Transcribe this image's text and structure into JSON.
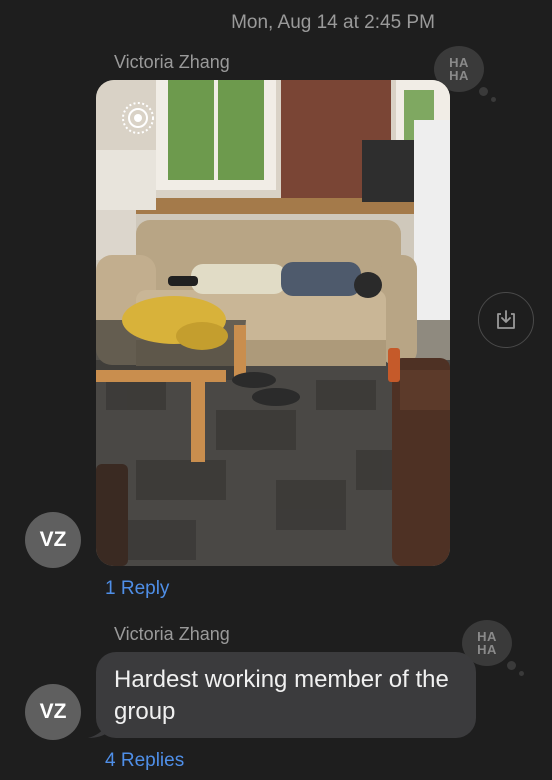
{
  "conversation": {
    "timestamp": "Mon, Aug 14 at 2:45 PM"
  },
  "messages": [
    {
      "sender": "Victoria Zhang",
      "avatar_initials": "VZ",
      "type": "photo",
      "tapback": "HA HA",
      "tapback_line1": "HA",
      "tapback_line2": "HA",
      "live_photo_icon": "live-photo-icon",
      "save_icon": "save-download-icon",
      "reply_count_label": "1 Reply"
    },
    {
      "sender": "Victoria Zhang",
      "avatar_initials": "VZ",
      "type": "text",
      "text": "Hardest working member of the group",
      "tapback": "HA HA",
      "tapback_line1": "HA",
      "tapback_line2": "HA",
      "reply_count_label": "4 Replies"
    }
  ],
  "colors": {
    "background": "#1e1e1e",
    "bubble": "#3b3b3d",
    "link": "#4f8fe8",
    "avatar": "#5f5f5f"
  }
}
